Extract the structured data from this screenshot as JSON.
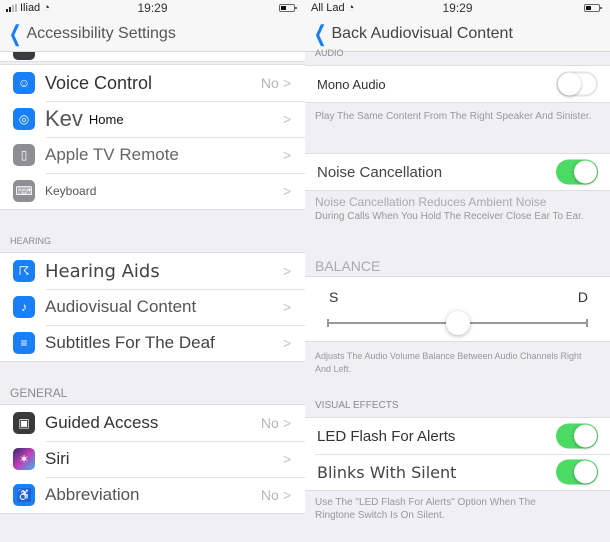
{
  "left": {
    "status": {
      "carrier": "Iliad",
      "time": "19:29"
    },
    "nav": {
      "back_label": "Accessibility Settings"
    },
    "group1": [
      {
        "label": "Voice Control",
        "value": "No",
        "icon": "voice-control-icon",
        "color": "#1a7ff6"
      },
      {
        "label": "Kev",
        "overlay": "Home",
        "icon": "home-button-icon",
        "color": "#1a7ff6"
      },
      {
        "label": "Apple TV Remote",
        "icon": "tv-remote-icon",
        "color": "#8e8e93"
      },
      {
        "label": "Keyboard",
        "icon": "keyboard-icon",
        "color": "#8e8e93"
      }
    ],
    "hearing_header": "HEARING",
    "hearing": [
      {
        "label": "Hearing Aids",
        "icon": "ear-icon",
        "color": "#1a7ff6"
      },
      {
        "label": "Audiovisual Content",
        "icon": "audiovisual-icon",
        "color": "#1a7ff6"
      },
      {
        "label": "Subtitles For The Deaf",
        "icon": "subtitles-icon",
        "color": "#1a7ff6"
      }
    ],
    "general_header": "GENERAL",
    "general": [
      {
        "label": "Guided Access",
        "value": "No",
        "icon": "lock-icon",
        "color": "#3a3a3c"
      },
      {
        "label": "Siri",
        "icon": "siri-icon",
        "color": "#5b3bb5"
      },
      {
        "label": "Abbreviation",
        "value": "No",
        "icon": "accessibility-icon",
        "color": "#1a7ff6"
      }
    ]
  },
  "right": {
    "status": {
      "carrier": "All Lad",
      "time": "19:29"
    },
    "nav": {
      "back_label": "Back Audiovisual Content"
    },
    "audio_header": "AUDIO",
    "mono_audio": {
      "label": "Mono Audio",
      "on": false
    },
    "mono_footer": "Play The Same Content From The Right Speaker And Sinister.",
    "noise": {
      "label": "Noise Cancellation",
      "on": true
    },
    "noise_footer_1": "Noise Cancellation Reduces Ambient Noise",
    "noise_footer_2": "During Calls When You Hold The Receiver Close Ear To Ear.",
    "balance_header": "BALANCE",
    "balance": {
      "left_label": "S",
      "right_label": "D",
      "value": 0.5
    },
    "balance_footer": "Adjusts The Audio Volume Balance Between Audio Channels Right And Left.",
    "visual_header": "VISUAL EFFECTS",
    "led_flash": {
      "label": "LED Flash For Alerts",
      "on": true
    },
    "blink_silent": {
      "label": "Blinks With Silent",
      "on": true
    },
    "visual_footer": "Use The \"LED Flash For Alerts\" Option When The Ringtone Switch Is On Silent."
  }
}
